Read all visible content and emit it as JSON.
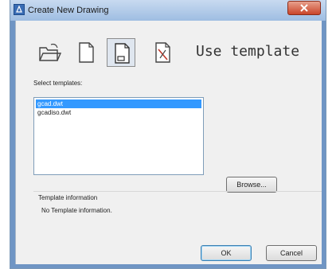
{
  "window": {
    "title": "Create New Drawing"
  },
  "toolbar": {
    "items": [
      {
        "name": "open-drawing-icon"
      },
      {
        "name": "start-from-scratch-icon"
      },
      {
        "name": "use-template-icon"
      },
      {
        "name": "use-wizard-icon"
      }
    ],
    "mode_label": "Use template"
  },
  "templates": {
    "label": "Select templates:",
    "items": [
      "gcad.dwt",
      "gcadiso.dwt"
    ],
    "selected": "gcad.dwt"
  },
  "buttons": {
    "browse": "Browse...",
    "ok": "OK",
    "cancel": "Cancel"
  },
  "info": {
    "label": "Template information",
    "text": "No Template information."
  }
}
